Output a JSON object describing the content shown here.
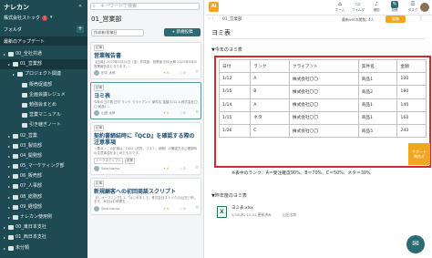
{
  "sidebar": {
    "brand": "ナレカン",
    "collapse_icon": "collapse-left-icon",
    "company": "株式会社ストック",
    "company_badge": "!",
    "folder_label": "フォルダ",
    "folder_add": "+",
    "recent_label": "最新のアップデート",
    "tree": [
      {
        "label": "00_全社共通",
        "indent": 0
      },
      {
        "label": "01_営業部",
        "indent": 1
      },
      {
        "label": "プロジェクト関連",
        "indent": 2
      },
      {
        "label": "販売促進部",
        "indent": 3
      },
      {
        "label": "企画会議レジュメ",
        "indent": 3
      },
      {
        "label": "勉強会まとめ",
        "indent": 3
      },
      {
        "label": "営業マニュアル",
        "indent": 3
      },
      {
        "label": "引き継ぎノート",
        "indent": 3
      },
      {
        "label": "02_営業",
        "indent": 1
      },
      {
        "label": "03_製造部",
        "indent": 1
      },
      {
        "label": "04_開発部",
        "indent": 1
      },
      {
        "label": "05_マーケティング部",
        "indent": 1
      },
      {
        "label": "06_販売部",
        "indent": 1
      },
      {
        "label": "07_人事部",
        "indent": 1
      },
      {
        "label": "08_総務部",
        "indent": 1
      },
      {
        "label": "09_経理部",
        "indent": 1
      },
      {
        "label": "ナレカン使用例",
        "indent": 1
      },
      {
        "label": "00_東日本支社",
        "indent": 0
      },
      {
        "label": "01_西日本支社",
        "indent": 0
      },
      {
        "label": "未分類",
        "indent": 0
      }
    ]
  },
  "list": {
    "search_placeholder": "キーワードで検索",
    "folder_title": "01_営業部",
    "filter_label": "作成者/投稿日",
    "new_post": "+ 新規投稿",
    "cards": [
      {
        "tag": "記事",
        "title": "営業報告書",
        "snippet": "【日時】2023年5月24日（金）作成者：営業部 田中太郎 2023年5月の営業報告書になります。…",
        "author": "田中 太郎",
        "likes": "0",
        "comments": "0"
      },
      {
        "tag": "記事",
        "title": "ヨミ表",
        "snippet": "今年のヨミ表 日付 ランク クライアント 案件名 金額 1/12 A 株式会社〇〇 商品1 …",
        "author": "山田 太郎",
        "likes": "0",
        "comments": "0"
      },
      {
        "tag": "記事",
        "title": "契約書締結時に『QCD』を確認する際の注意事項",
        "snippet": "＜要点＞この記事は、QCD（品質、コスト、納期）の確認方法と確認時の注意事項をまとめたものです。",
        "author": "Sato Isamu",
        "likes": "0",
        "comments": "0",
        "tags": [
          "トークスクリプト",
          "営業"
        ]
      },
      {
        "tag": "記事",
        "title": "新規顧客への初回商談スクリプト",
        "snippet": "【1. オープニング】1.「はじめまして。株式会社ストックの山田と申します。本日はお時間を…",
        "author": "Sato Isamu",
        "likes": "0",
        "comments": "0"
      }
    ]
  },
  "topbar": {
    "logo": "Ai",
    "buttons": [
      {
        "icon": "home-icon",
        "glyph": "⌂",
        "label": "ホーム"
      },
      {
        "icon": "folder-icon",
        "glyph": "▭",
        "label": "フォルダ"
      },
      {
        "icon": "bell-icon",
        "glyph": "♪",
        "label": "通知"
      },
      {
        "icon": "edit-icon",
        "glyph": "✎",
        "label": "投稿"
      },
      {
        "icon": "tasks-icon",
        "glyph": "☰",
        "label": "タスク"
      }
    ]
  },
  "doc_header": {
    "folder": "01_営業部",
    "version_label": "最新verの閲覧:",
    "version_count": "4人",
    "edit_label": "編集"
  },
  "document": {
    "title": "ヨミ表",
    "section1": "▼今年のヨミ表",
    "table": [
      [
        "日付",
        "ランク",
        "クライアント",
        "案件名",
        "金額"
      ],
      [
        "1/12",
        "A",
        "株式会社〇〇",
        "商品1",
        "100"
      ],
      [
        "1/15",
        "B",
        "株式会社〇〇",
        "商品2",
        "180"
      ],
      [
        "1/14",
        "A",
        "株式会社〇〇",
        "商品1",
        "140"
      ],
      [
        "1/15",
        "ネタ",
        "株式会社〇〇",
        "商品1",
        "160"
      ],
      [
        "1/26",
        "C",
        "株式会社〇〇",
        "商品5",
        "240"
      ]
    ],
    "support_label": "サポート\n問合せ",
    "note": "※表中のランク：A＝受注確度90%、B＝70%、C＝50%、ネタ＝30%",
    "section2": "▼昨年度のヨミ表",
    "attachment": {
      "name": "ヨミ表.xlsx",
      "date": "5/16(木) 12:41 更新済み",
      "user": "山田太郎",
      "icon": "excel-file-icon"
    }
  },
  "colors": {
    "sidebar": "#1e4a53",
    "accent": "#2c6a74",
    "orange": "#f0a61f",
    "highlight": "#d8282f"
  }
}
